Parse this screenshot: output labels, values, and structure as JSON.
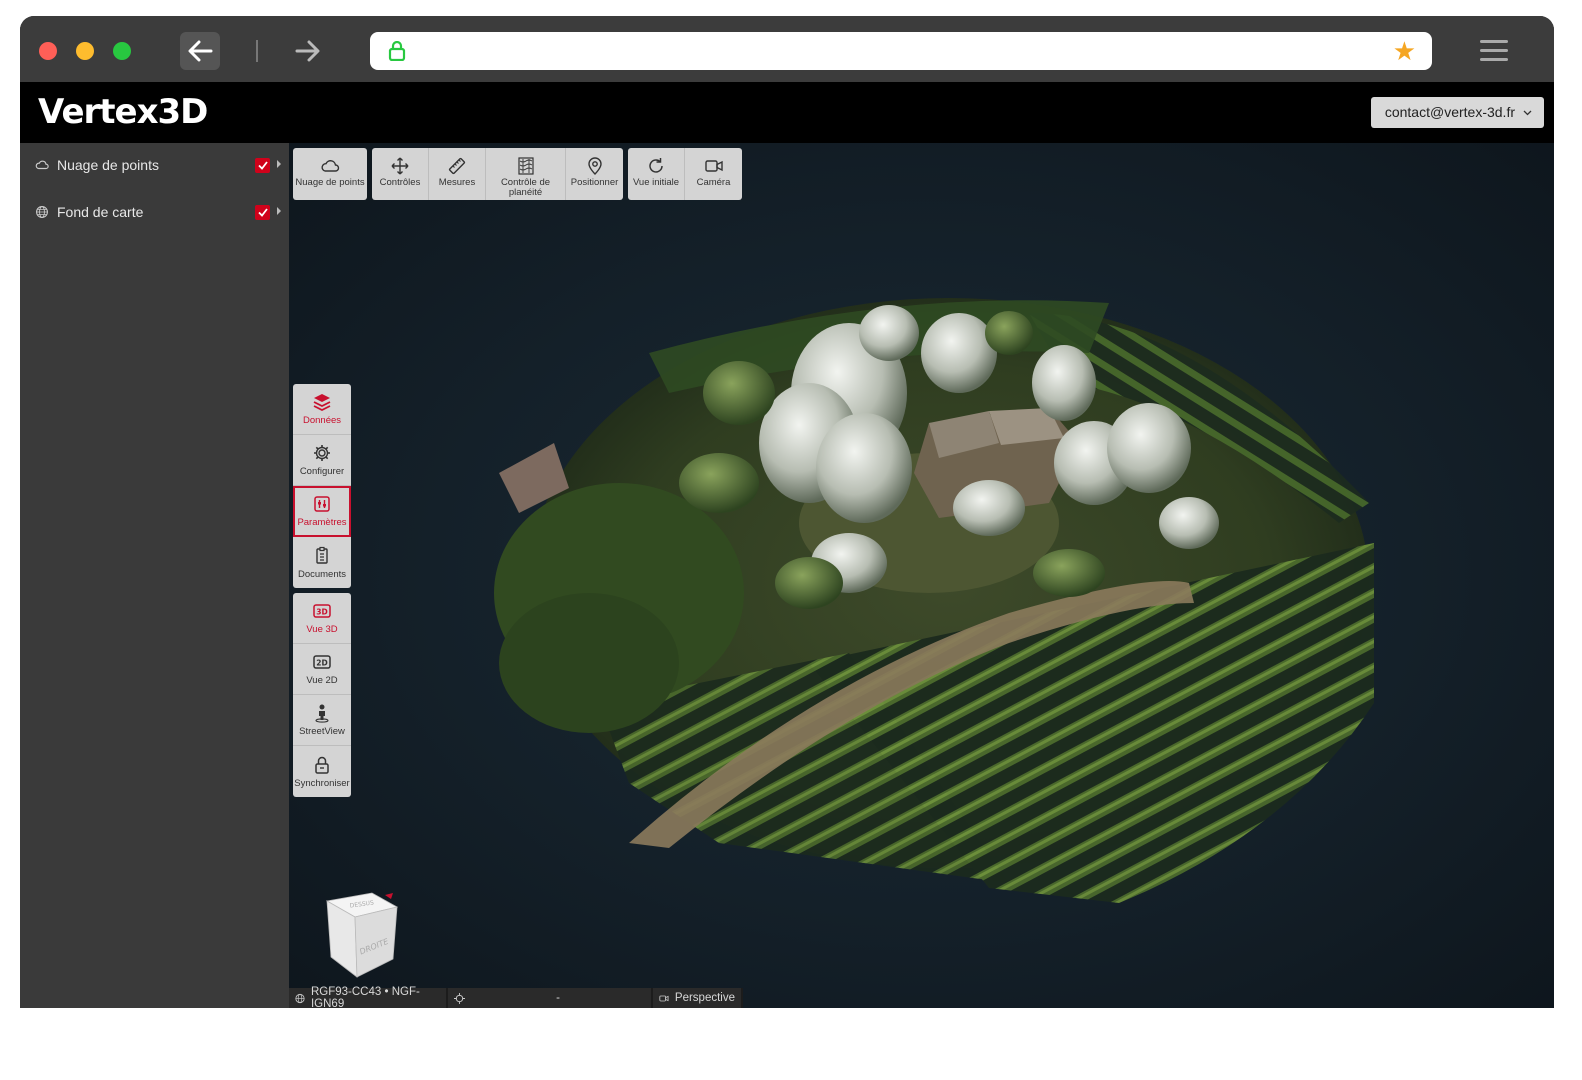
{
  "browser": {
    "icons": {
      "back": "arrow-left-icon",
      "forward": "arrow-right-icon",
      "lock": "lock-icon",
      "bookmark": "star-icon",
      "menu": "hamburger-icon"
    },
    "colors": {
      "close": "#ff5f57",
      "minimize": "#febc2e",
      "maximize": "#28c840",
      "bookmark": "#f5a623"
    }
  },
  "app": {
    "logo": "Vertex3D",
    "account": "contact@vertex-3d.fr"
  },
  "sidebar": {
    "layers": [
      {
        "label": "Nuage de points",
        "icon": "cloud-icon",
        "checked": true
      },
      {
        "label": "Fond de carte",
        "icon": "globe-icon",
        "checked": true
      }
    ]
  },
  "toolbar": {
    "groups": [
      [
        {
          "label": "Nuage de points",
          "icon": "cloud-icon"
        }
      ],
      [
        {
          "label": "Contrôles",
          "icon": "move-icon"
        },
        {
          "label": "Mesures",
          "icon": "ruler-icon"
        },
        {
          "label": "Contrôle de planéité",
          "icon": "flatness-icon"
        },
        {
          "label": "Positionner",
          "icon": "pin-icon"
        }
      ],
      [
        {
          "label": "Vue initiale",
          "icon": "reset-view-icon"
        },
        {
          "label": "Caméra",
          "icon": "camera-icon"
        }
      ]
    ]
  },
  "side_tools": {
    "group1": [
      {
        "label": "Données",
        "icon": "layers-icon",
        "state": "active"
      },
      {
        "label": "Configurer",
        "icon": "gear-icon",
        "state": "normal"
      },
      {
        "label": "Paramètres",
        "icon": "sliders-icon",
        "state": "selected"
      },
      {
        "label": "Documents",
        "icon": "documents-icon",
        "state": "normal"
      }
    ],
    "group2": [
      {
        "label": "Vue 3D",
        "icon": "view-3d-icon",
        "state": "active"
      },
      {
        "label": "Vue 2D",
        "icon": "view-2d-icon",
        "state": "normal"
      },
      {
        "label": "StreetView",
        "icon": "person-icon",
        "state": "normal"
      },
      {
        "label": "Synchroniser",
        "icon": "lock-icon",
        "state": "normal"
      }
    ]
  },
  "navcube": {
    "face_front": "DROITE",
    "face_top": "DESSUS"
  },
  "status": {
    "crs": "RGF93-CC43 • NGF-IGN69",
    "coords": "-",
    "projection": "Perspective"
  },
  "accent_color": "#c8102e"
}
